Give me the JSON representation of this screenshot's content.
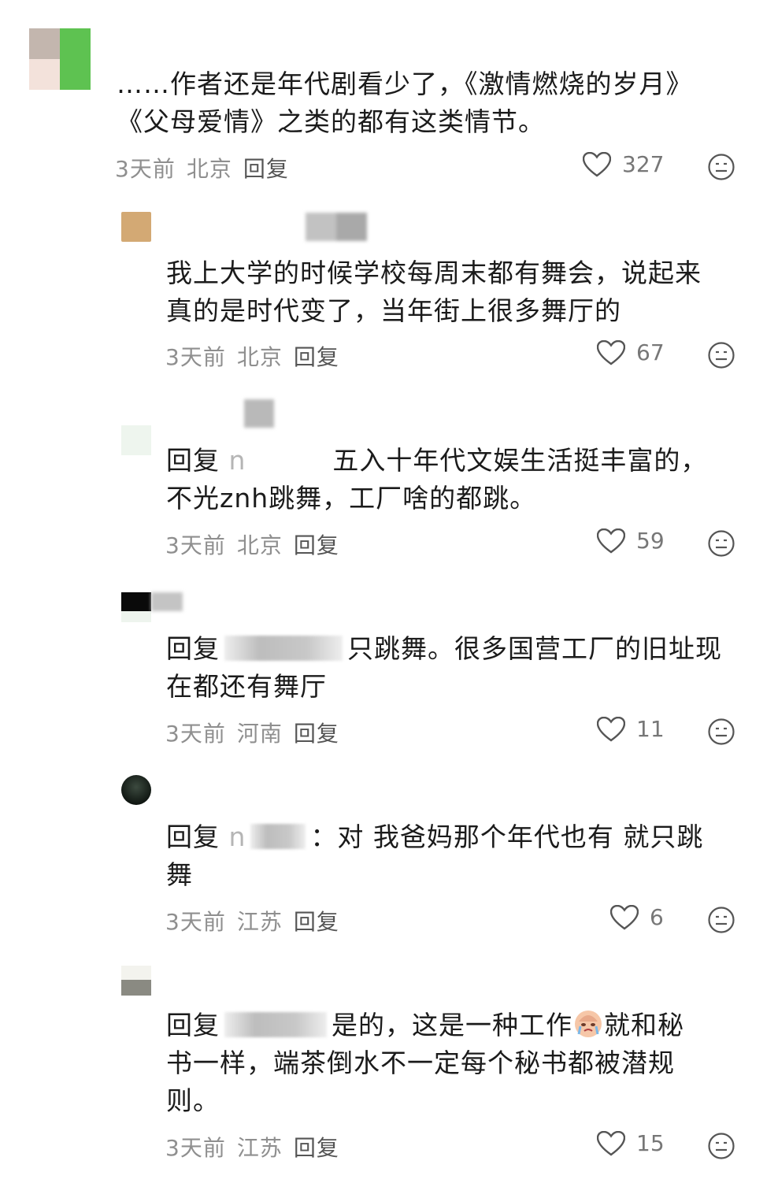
{
  "comments": [
    {
      "text": "……作者还是年代剧看少了，《激情燃烧的岁月》《父母爱情》之类的都有这类情节。",
      "line1": "……作者还是年代剧看少了，《激情燃烧的岁月》",
      "line2": "《父母爱情》之类的都有这类情节。",
      "time": "3天前",
      "location": "北京",
      "reply_label": "回复",
      "likes": "327"
    },
    {
      "line1": "我上大学的时候学校每周末都有舞会，说起来",
      "line2": "真的是时代变了，当年街上很多舞厅的",
      "time": "3天前",
      "location": "北京",
      "reply_label": "回复",
      "likes": "67"
    },
    {
      "prefix": "回复",
      "partial_name": "n",
      "line1_rest": "五入十年代文娱生活挺丰富的，",
      "line2": "不光znh跳舞，工厂啥的都跳。",
      "time": "3天前",
      "location": "北京",
      "reply_label": "回复",
      "likes": "59"
    },
    {
      "prefix": "回复",
      "line1_rest": "只跳舞。很多国营工厂的旧址现",
      "line2": "在都还有舞厅",
      "time": "3天前",
      "location": "河南",
      "reply_label": "回复",
      "likes": "11"
    },
    {
      "prefix": "回复",
      "partial_name": "n",
      "line1_rest": "：对 我爸妈那个年代也有 就只跳",
      "line2": "舞",
      "time": "3天前",
      "location": "江苏",
      "reply_label": "回复",
      "likes": "6"
    },
    {
      "prefix": "回复",
      "line1_before_emoji": "是的，这是一种工作",
      "line1_after_emoji": "就和秘",
      "line2": "书一样，端茶倒水不一定每个秘书都被潜规",
      "line3": "则。",
      "time": "3天前",
      "location": "江苏",
      "reply_label": "回复",
      "likes": "15"
    }
  ],
  "colors": {
    "text": "#1b1b1b",
    "meta": "#8f8f8f",
    "icon": "#555555"
  }
}
